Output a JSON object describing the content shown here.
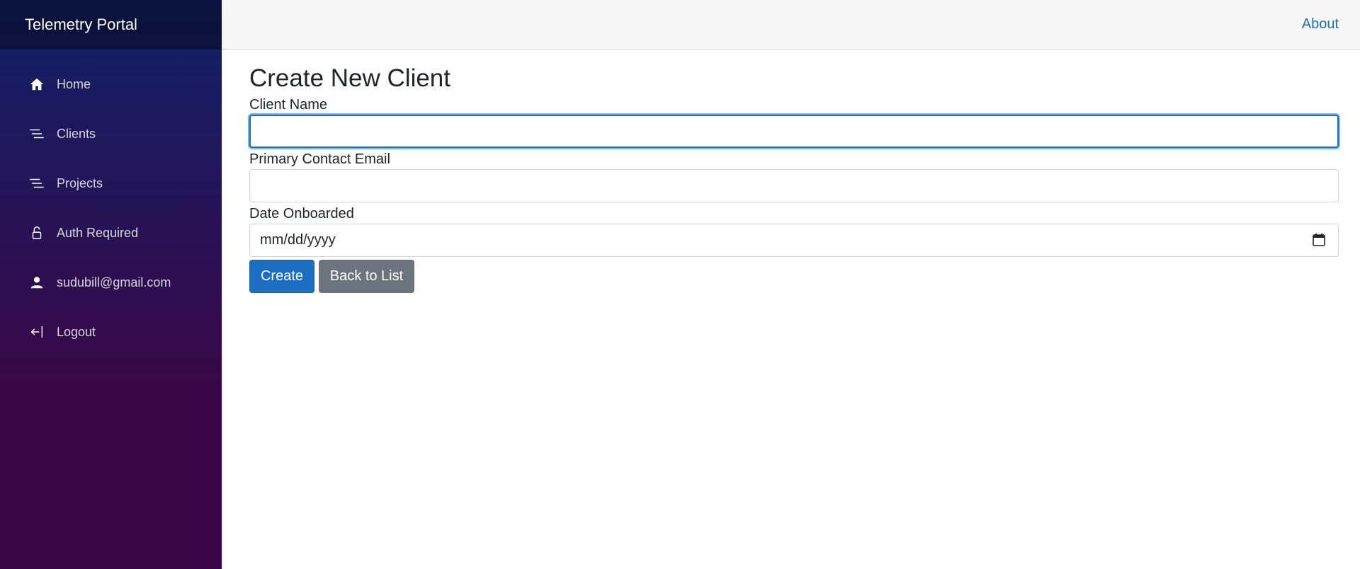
{
  "app": {
    "title": "Telemetry Portal"
  },
  "sidebar": {
    "items": [
      {
        "label": "Home",
        "icon": "home-icon"
      },
      {
        "label": "Clients",
        "icon": "list-icon"
      },
      {
        "label": "Projects",
        "icon": "list-icon"
      },
      {
        "label": "Auth Required",
        "icon": "lock-icon"
      },
      {
        "label": "sudubill@gmail.com",
        "icon": "person-icon"
      },
      {
        "label": "Logout",
        "icon": "logout-icon"
      }
    ]
  },
  "topbar": {
    "about_label": "About"
  },
  "page": {
    "title": "Create New Client",
    "fields": {
      "client_name": {
        "label": "Client Name",
        "value": ""
      },
      "primary_contact_email": {
        "label": "Primary Contact Email",
        "value": ""
      },
      "date_onboarded": {
        "label": "Date Onboarded",
        "placeholder": "mm/dd/yyyy"
      }
    },
    "buttons": {
      "create": "Create",
      "back": "Back to List"
    }
  },
  "colors": {
    "accent": "#1b6ec2",
    "sidebar_top": "#0f2167",
    "sidebar_bottom": "#3a0647",
    "secondary_button": "#6c757d"
  }
}
